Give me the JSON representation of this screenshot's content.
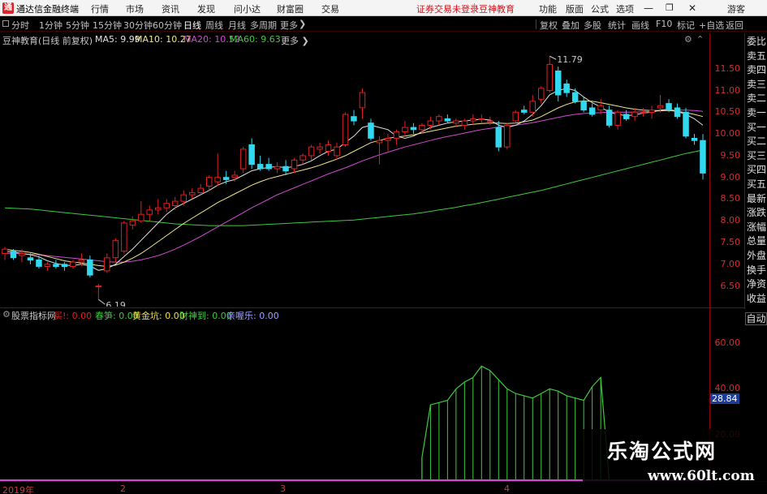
{
  "titlebar": {
    "app_title": "通达信金融终端",
    "menu": [
      "行情",
      "市场",
      "资讯",
      "发现",
      "问小达",
      "财富圈",
      "交易"
    ],
    "notice": "证券交易未登录",
    "brand": "豆神教育",
    "right_menu": [
      "功能",
      "版面",
      "公式",
      "选项"
    ],
    "guest": "游客"
  },
  "period_bar": {
    "periods": [
      "分时",
      "1分钟",
      "5分钟",
      "15分钟",
      "30分钟",
      "60分钟",
      "日线",
      "周线",
      "月线",
      "多周期",
      "更多"
    ],
    "active_period": "日线",
    "right_buttons": [
      "复权",
      "叠加",
      "多股",
      "统计",
      "画线",
      "F10",
      "标记",
      "+自选",
      "返回"
    ]
  },
  "chart_info": {
    "title": "豆神教育(日线 前复权)",
    "ma5": "MA5: 9.99",
    "ma10": "MA10: 10.27",
    "ma20": "MA20: 10.52",
    "ma60": "MA60: 9.63",
    "colors": {
      "ma5": "#e0e0e0",
      "ma10": "#f0e68c",
      "ma20": "#d04ad0",
      "ma60": "#3ec93e",
      "up": "#e02020",
      "down": "#30d8f0"
    }
  },
  "price_axis": [
    "11.50",
    "11.00",
    "10.50",
    "10.00",
    "9.50",
    "9.00",
    "8.50",
    "8.00",
    "7.50",
    "7.00",
    "6.50"
  ],
  "annotations": {
    "high": "11.79",
    "low": "6.19"
  },
  "right_tabs": [
    "委比",
    "卖五",
    "卖四",
    "卖三",
    "卖二",
    "卖一",
    "买一",
    "买二",
    "买三",
    "买四",
    "买五",
    "最新",
    "涨跌",
    "涨幅",
    "总量",
    "外盘",
    "换手",
    "净资",
    "收益"
  ],
  "indicator": {
    "name": "股票指标网",
    "buy": "买!: 0.00",
    "spring": "春笋: 0.00",
    "gold": "黄金坑: 0.00",
    "god": "财神到: 0.00",
    "joy": "亲喔乐: 0.00",
    "axis": [
      "60.00",
      "40.00",
      "20.00"
    ],
    "current": "28.84",
    "auto": "自动"
  },
  "date_axis": [
    "2019年",
    "2",
    "3",
    "4"
  ],
  "watermark": {
    "title": "乐淘公式网",
    "url": "www.60lt.com"
  },
  "chart_data": {
    "type": "candlestick",
    "title": "豆神教育(日线 前复权)",
    "ylim": [
      6.1,
      12.0
    ],
    "candles": [
      {
        "o": 7.25,
        "h": 7.4,
        "l": 7.1,
        "c": 7.35
      },
      {
        "o": 7.3,
        "h": 7.35,
        "l": 7.1,
        "c": 7.15
      },
      {
        "o": 7.2,
        "h": 7.35,
        "l": 7.05,
        "c": 7.25
      },
      {
        "o": 7.15,
        "h": 7.25,
        "l": 7.0,
        "c": 7.1
      },
      {
        "o": 7.1,
        "h": 7.2,
        "l": 6.9,
        "c": 6.95
      },
      {
        "o": 6.95,
        "h": 7.05,
        "l": 6.85,
        "c": 7.0
      },
      {
        "o": 7.0,
        "h": 7.1,
        "l": 6.9,
        "c": 6.95
      },
      {
        "o": 7.0,
        "h": 7.05,
        "l": 6.85,
        "c": 6.95
      },
      {
        "o": 6.95,
        "h": 7.1,
        "l": 6.9,
        "c": 7.05
      },
      {
        "o": 7.05,
        "h": 7.25,
        "l": 6.95,
        "c": 7.1
      },
      {
        "o": 7.1,
        "h": 7.2,
        "l": 6.7,
        "c": 6.75
      },
      {
        "o": 6.5,
        "h": 6.55,
        "l": 6.19,
        "c": 6.5
      },
      {
        "o": 6.85,
        "h": 7.25,
        "l": 6.8,
        "c": 7.15
      },
      {
        "o": 7.15,
        "h": 7.6,
        "l": 7.05,
        "c": 7.55
      },
      {
        "o": 7.3,
        "h": 8.0,
        "l": 7.25,
        "c": 7.95
      },
      {
        "o": 7.9,
        "h": 8.1,
        "l": 7.8,
        "c": 8.0
      },
      {
        "o": 8.0,
        "h": 8.45,
        "l": 7.95,
        "c": 8.15
      },
      {
        "o": 8.15,
        "h": 8.35,
        "l": 8.0,
        "c": 8.25
      },
      {
        "o": 8.25,
        "h": 8.5,
        "l": 8.15,
        "c": 8.3
      },
      {
        "o": 8.3,
        "h": 8.5,
        "l": 8.2,
        "c": 8.4
      },
      {
        "o": 8.35,
        "h": 8.55,
        "l": 8.25,
        "c": 8.45
      },
      {
        "o": 8.45,
        "h": 8.7,
        "l": 8.35,
        "c": 8.6
      },
      {
        "o": 8.6,
        "h": 8.75,
        "l": 8.5,
        "c": 8.65
      },
      {
        "o": 8.65,
        "h": 8.85,
        "l": 8.6,
        "c": 8.75
      },
      {
        "o": 8.8,
        "h": 9.05,
        "l": 8.7,
        "c": 9.0
      },
      {
        "o": 8.9,
        "h": 9.55,
        "l": 8.8,
        "c": 9.0
      },
      {
        "o": 9.0,
        "h": 9.15,
        "l": 8.85,
        "c": 8.95
      },
      {
        "o": 9.0,
        "h": 9.15,
        "l": 8.9,
        "c": 9.05
      },
      {
        "o": 9.2,
        "h": 9.7,
        "l": 9.1,
        "c": 9.65
      },
      {
        "o": 9.75,
        "h": 9.9,
        "l": 9.2,
        "c": 9.3
      },
      {
        "o": 9.3,
        "h": 9.5,
        "l": 9.15,
        "c": 9.2
      },
      {
        "o": 9.3,
        "h": 9.45,
        "l": 9.15,
        "c": 9.2
      },
      {
        "o": 9.2,
        "h": 9.35,
        "l": 9.1,
        "c": 9.25
      },
      {
        "o": 9.25,
        "h": 9.4,
        "l": 9.05,
        "c": 9.15
      },
      {
        "o": 9.2,
        "h": 9.45,
        "l": 9.1,
        "c": 9.4
      },
      {
        "o": 9.4,
        "h": 9.55,
        "l": 9.3,
        "c": 9.5
      },
      {
        "o": 9.5,
        "h": 9.75,
        "l": 9.4,
        "c": 9.7
      },
      {
        "o": 9.65,
        "h": 9.8,
        "l": 9.55,
        "c": 9.7
      },
      {
        "o": 9.6,
        "h": 9.85,
        "l": 9.5,
        "c": 9.75
      },
      {
        "o": 9.5,
        "h": 9.8,
        "l": 9.4,
        "c": 9.7
      },
      {
        "o": 9.75,
        "h": 10.5,
        "l": 9.7,
        "c": 10.45
      },
      {
        "o": 10.4,
        "h": 10.55,
        "l": 10.2,
        "c": 10.3
      },
      {
        "o": 10.6,
        "h": 11.05,
        "l": 10.35,
        "c": 10.95
      },
      {
        "o": 10.25,
        "h": 10.35,
        "l": 9.85,
        "c": 9.9
      },
      {
        "o": 9.8,
        "h": 9.95,
        "l": 9.3,
        "c": 9.85
      },
      {
        "o": 9.85,
        "h": 10.0,
        "l": 9.6,
        "c": 9.9
      },
      {
        "o": 9.9,
        "h": 10.1,
        "l": 9.75,
        "c": 10.05
      },
      {
        "o": 10.05,
        "h": 10.3,
        "l": 9.95,
        "c": 10.15
      },
      {
        "o": 10.15,
        "h": 10.25,
        "l": 10.0,
        "c": 10.1
      },
      {
        "o": 10.1,
        "h": 10.25,
        "l": 10.0,
        "c": 10.2
      },
      {
        "o": 10.2,
        "h": 10.4,
        "l": 10.1,
        "c": 10.3
      },
      {
        "o": 10.3,
        "h": 10.45,
        "l": 10.2,
        "c": 10.4
      },
      {
        "o": 10.35,
        "h": 10.45,
        "l": 10.25,
        "c": 10.3
      },
      {
        "o": 10.25,
        "h": 10.35,
        "l": 10.15,
        "c": 10.3
      },
      {
        "o": 10.2,
        "h": 10.35,
        "l": 10.1,
        "c": 10.3
      },
      {
        "o": 10.3,
        "h": 10.45,
        "l": 10.2,
        "c": 10.35
      },
      {
        "o": 10.35,
        "h": 10.45,
        "l": 10.25,
        "c": 10.35
      },
      {
        "o": 10.3,
        "h": 10.4,
        "l": 10.2,
        "c": 10.3
      },
      {
        "o": 10.15,
        "h": 10.3,
        "l": 9.6,
        "c": 9.7
      },
      {
        "o": 9.7,
        "h": 10.25,
        "l": 9.65,
        "c": 10.2
      },
      {
        "o": 10.3,
        "h": 10.55,
        "l": 10.25,
        "c": 10.5
      },
      {
        "o": 10.55,
        "h": 10.65,
        "l": 10.45,
        "c": 10.5
      },
      {
        "o": 10.5,
        "h": 10.9,
        "l": 10.4,
        "c": 10.75
      },
      {
        "o": 10.8,
        "h": 11.1,
        "l": 10.7,
        "c": 11.05
      },
      {
        "o": 11.0,
        "h": 11.79,
        "l": 10.95,
        "c": 11.6
      },
      {
        "o": 11.45,
        "h": 11.55,
        "l": 10.75,
        "c": 10.9
      },
      {
        "o": 11.15,
        "h": 11.25,
        "l": 10.85,
        "c": 10.95
      },
      {
        "o": 10.95,
        "h": 11.05,
        "l": 10.7,
        "c": 10.75
      },
      {
        "o": 10.75,
        "h": 10.85,
        "l": 10.5,
        "c": 10.55
      },
      {
        "o": 10.6,
        "h": 10.7,
        "l": 10.4,
        "c": 10.45
      },
      {
        "o": 10.55,
        "h": 10.8,
        "l": 10.45,
        "c": 10.65
      },
      {
        "o": 10.55,
        "h": 10.65,
        "l": 10.15,
        "c": 10.2
      },
      {
        "o": 10.2,
        "h": 10.55,
        "l": 10.1,
        "c": 10.5
      },
      {
        "o": 10.45,
        "h": 10.55,
        "l": 10.3,
        "c": 10.35
      },
      {
        "o": 10.4,
        "h": 10.6,
        "l": 10.3,
        "c": 10.5
      },
      {
        "o": 10.5,
        "h": 10.6,
        "l": 10.4,
        "c": 10.5
      },
      {
        "o": 10.5,
        "h": 10.65,
        "l": 10.35,
        "c": 10.55
      },
      {
        "o": 10.6,
        "h": 10.9,
        "l": 10.5,
        "c": 10.65
      },
      {
        "o": 10.7,
        "h": 10.8,
        "l": 10.5,
        "c": 10.55
      },
      {
        "o": 10.6,
        "h": 10.7,
        "l": 10.35,
        "c": 10.4
      },
      {
        "o": 10.5,
        "h": 10.6,
        "l": 9.9,
        "c": 9.95
      },
      {
        "o": 9.9,
        "h": 10.0,
        "l": 9.75,
        "c": 9.85
      },
      {
        "o": 9.85,
        "h": 10.0,
        "l": 8.95,
        "c": 9.1
      }
    ],
    "ma": {
      "ma5": [
        7.3,
        7.28,
        7.25,
        7.22,
        7.17,
        7.08,
        7.02,
        6.98,
        6.97,
        7.0,
        6.96,
        6.86,
        6.9,
        7.0,
        7.18,
        7.35,
        7.55,
        7.75,
        7.95,
        8.15,
        8.3,
        8.4,
        8.5,
        8.6,
        8.7,
        8.82,
        8.9,
        8.95,
        9.05,
        9.15,
        9.2,
        9.23,
        9.25,
        9.22,
        9.25,
        9.3,
        9.38,
        9.5,
        9.6,
        9.65,
        9.8,
        9.95,
        10.15,
        10.2,
        10.15,
        10.1,
        9.95,
        9.9,
        9.95,
        10.05,
        10.15,
        10.2,
        10.25,
        10.28,
        10.3,
        10.32,
        10.34,
        10.32,
        10.2,
        10.15,
        10.2,
        10.3,
        10.45,
        10.65,
        10.9,
        11.0,
        11.05,
        11.0,
        10.85,
        10.72,
        10.62,
        10.5,
        10.45,
        10.42,
        10.44,
        10.48,
        10.5,
        10.55,
        10.57,
        10.52,
        10.45,
        10.35,
        10.2
      ],
      "ma10": [
        7.35,
        7.32,
        7.3,
        7.27,
        7.23,
        7.18,
        7.13,
        7.08,
        7.05,
        7.03,
        7.0,
        6.97,
        6.95,
        6.98,
        7.05,
        7.14,
        7.25,
        7.38,
        7.52,
        7.66,
        7.8,
        7.94,
        8.06,
        8.18,
        8.3,
        8.42,
        8.52,
        8.62,
        8.72,
        8.82,
        8.9,
        8.97,
        9.02,
        9.07,
        9.12,
        9.17,
        9.22,
        9.28,
        9.35,
        9.42,
        9.5,
        9.6,
        9.7,
        9.8,
        9.85,
        9.9,
        9.93,
        9.95,
        9.98,
        10.02,
        10.06,
        10.1,
        10.14,
        10.18,
        10.2,
        10.22,
        10.24,
        10.25,
        10.25,
        10.24,
        10.25,
        10.28,
        10.32,
        10.4,
        10.5,
        10.6,
        10.68,
        10.74,
        10.76,
        10.75,
        10.72,
        10.68,
        10.64,
        10.6,
        10.57,
        10.55,
        10.54,
        10.54,
        10.54,
        10.52,
        10.49,
        10.45,
        10.4
      ],
      "ma20": [
        7.25,
        7.25,
        7.24,
        7.23,
        7.22,
        7.2,
        7.18,
        7.16,
        7.14,
        7.12,
        7.1,
        7.08,
        7.06,
        7.05,
        7.05,
        7.07,
        7.1,
        7.15,
        7.2,
        7.27,
        7.35,
        7.44,
        7.54,
        7.64,
        7.75,
        7.86,
        7.97,
        8.08,
        8.19,
        8.3,
        8.4,
        8.5,
        8.6,
        8.68,
        8.76,
        8.84,
        8.92,
        9.0,
        9.08,
        9.15,
        9.22,
        9.3,
        9.38,
        9.45,
        9.52,
        9.58,
        9.64,
        9.7,
        9.75,
        9.8,
        9.85,
        9.9,
        9.94,
        9.98,
        10.02,
        10.06,
        10.1,
        10.13,
        10.16,
        10.18,
        10.2,
        10.23,
        10.26,
        10.3,
        10.34,
        10.38,
        10.42,
        10.45,
        10.47,
        10.48,
        10.49,
        10.5,
        10.5,
        10.5,
        10.5,
        10.51,
        10.52,
        10.53,
        10.54,
        10.55,
        10.55,
        10.54,
        10.52
      ],
      "ma60": [
        8.3,
        8.29,
        8.28,
        8.27,
        8.25,
        8.23,
        8.21,
        8.19,
        8.17,
        8.15,
        8.13,
        8.11,
        8.09,
        8.07,
        8.05,
        8.03,
        8.01,
        7.99,
        7.97,
        7.95,
        7.93,
        7.92,
        7.91,
        7.9,
        7.89,
        7.89,
        7.89,
        7.89,
        7.89,
        7.9,
        7.91,
        7.92,
        7.93,
        7.94,
        7.95,
        7.96,
        7.97,
        7.98,
        7.99,
        8.0,
        8.01,
        8.02,
        8.04,
        8.06,
        8.08,
        8.1,
        8.12,
        8.14,
        8.16,
        8.19,
        8.22,
        8.25,
        8.28,
        8.31,
        8.35,
        8.38,
        8.42,
        8.46,
        8.5,
        8.54,
        8.58,
        8.62,
        8.66,
        8.7,
        8.75,
        8.8,
        8.85,
        8.9,
        8.95,
        9.0,
        9.05,
        9.1,
        9.15,
        9.2,
        9.25,
        9.3,
        9.35,
        9.4,
        9.45,
        9.5,
        9.55,
        9.59,
        9.63
      ]
    },
    "indicator_values": [
      0,
      0,
      0,
      0,
      0,
      0,
      0,
      0,
      0,
      0,
      0,
      0,
      0,
      0,
      0,
      0,
      0,
      0,
      0,
      0,
      0,
      0,
      0,
      0,
      0,
      0,
      0,
      0,
      0,
      0,
      0,
      0,
      0,
      0,
      0,
      0,
      0,
      0,
      0,
      0,
      0,
      0,
      0,
      0,
      0,
      0,
      0,
      0,
      0,
      10,
      33,
      34,
      35,
      40,
      43,
      45,
      50,
      48,
      44,
      40,
      38,
      37,
      36,
      38,
      40,
      39,
      37,
      36,
      35,
      41,
      45,
      0,
      0,
      0,
      0,
      0,
      0,
      0,
      0,
      0,
      0,
      0,
      0
    ],
    "indicator_ylim": [
      0,
      70
    ]
  }
}
